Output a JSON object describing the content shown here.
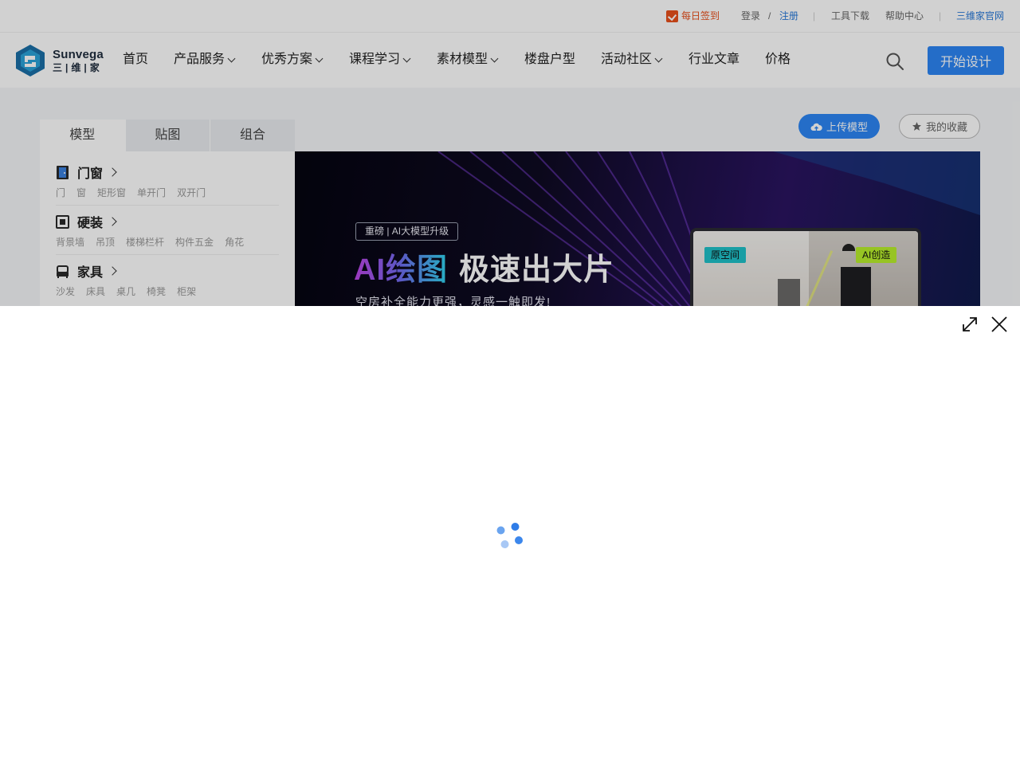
{
  "topbar": {
    "checkin_label": "每日签到",
    "login": "登录",
    "slash": "/",
    "register": "注册",
    "tools": "工具下载",
    "help": "帮助中心",
    "official_site": "三维家官网",
    "divider": "|"
  },
  "logo": {
    "en": "Sunvega",
    "cn": "三|维|家"
  },
  "nav": {
    "items": [
      {
        "label": "首页",
        "has_dropdown": false
      },
      {
        "label": "产品服务",
        "has_dropdown": true
      },
      {
        "label": "优秀方案",
        "has_dropdown": true
      },
      {
        "label": "课程学习",
        "has_dropdown": true
      },
      {
        "label": "素材模型",
        "has_dropdown": true
      },
      {
        "label": "楼盘户型",
        "has_dropdown": false
      },
      {
        "label": "活动社区",
        "has_dropdown": true
      },
      {
        "label": "行业文章",
        "has_dropdown": false
      },
      {
        "label": "价格",
        "has_dropdown": false
      }
    ],
    "search_icon": "search-icon",
    "start_label": "开始设计"
  },
  "side": {
    "tabs": [
      "模型",
      "贴图",
      "组合"
    ],
    "categories": [
      {
        "title": "门窗",
        "icon": "door-icon",
        "subs": [
          "门",
          "窗",
          "矩形窗",
          "单开门",
          "双开门"
        ]
      },
      {
        "title": "硬装",
        "icon": "frame-icon",
        "subs": [
          "背景墙",
          "吊顶",
          "楼梯栏杆",
          "构件五金",
          "角花"
        ]
      },
      {
        "title": "家具",
        "icon": "sofa-icon",
        "subs": [
          "沙发",
          "床具",
          "桌几",
          "椅凳",
          "柜架"
        ]
      }
    ]
  },
  "actions": {
    "upload_label": "上传模型",
    "favorites_label": "我的收藏"
  },
  "banner": {
    "tag": "重磅 | AI大模型升级",
    "title_ai": "AI绘图",
    "title_rest": "极速出大片",
    "subtitle": "空房补全能力更强，灵感一触即发!",
    "label_original": "原空间",
    "label_ai": "AI创造"
  },
  "colors": {
    "primary": "#2c86f5",
    "checkin": "#e8501c",
    "link": "#2778d8"
  },
  "modal": {
    "state": "loading",
    "expand_icon": "expand-icon",
    "close_icon": "close-icon"
  }
}
